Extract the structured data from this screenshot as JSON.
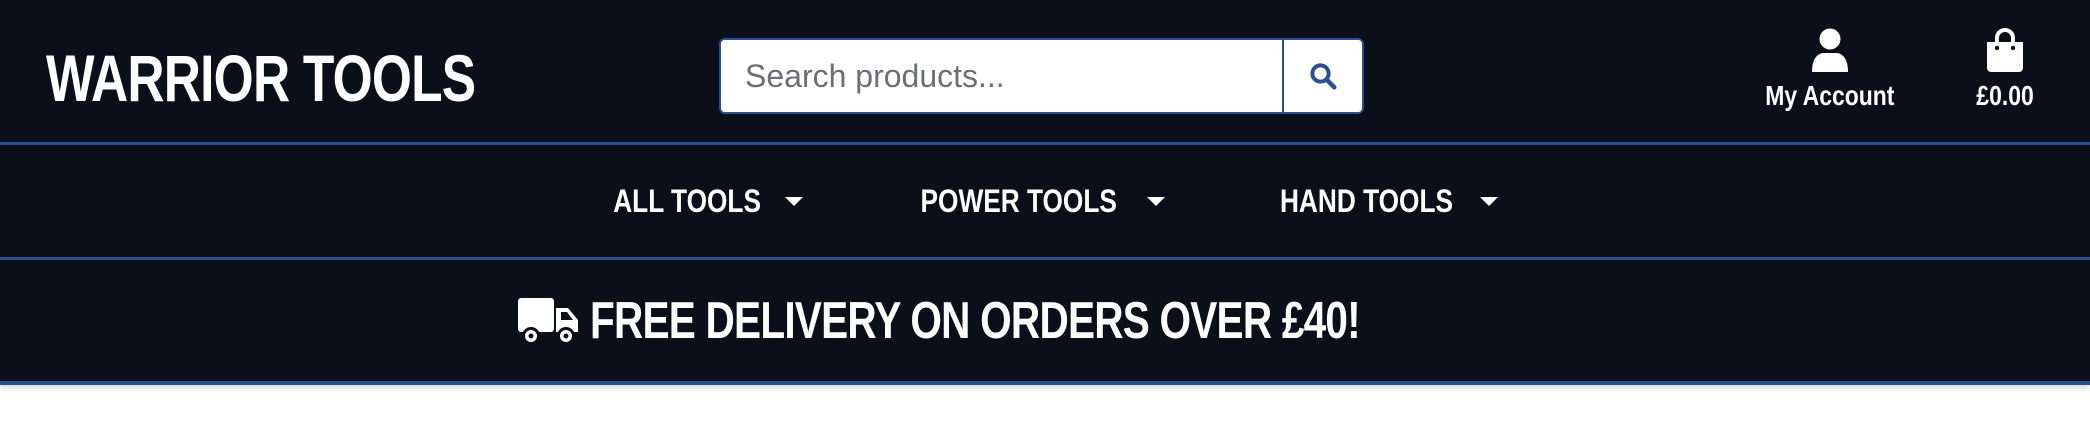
{
  "header": {
    "logo_text": "WARRIOR TOOLS",
    "search": {
      "placeholder": "Search products...",
      "value": "",
      "button_icon": "search-icon"
    },
    "account": {
      "label": "My Account",
      "icon": "user-icon"
    },
    "cart": {
      "label": "£0.00",
      "icon": "shopping-bag-icon"
    }
  },
  "nav": {
    "items": [
      {
        "label": "ALL TOOLS",
        "icon": "chevron-down-icon"
      },
      {
        "label": "POWER TOOLS",
        "icon": "chevron-down-icon"
      },
      {
        "label": "HAND TOOLS",
        "icon": "chevron-down-icon"
      }
    ]
  },
  "banner": {
    "icon": "truck-icon",
    "text": "FREE DELIVERY ON ORDERS OVER £40!"
  },
  "colors": {
    "background": "#0b0f1a",
    "accent_border": "#2c4f8f",
    "search_icon": "#2c4f8f",
    "text": "#ffffff"
  }
}
